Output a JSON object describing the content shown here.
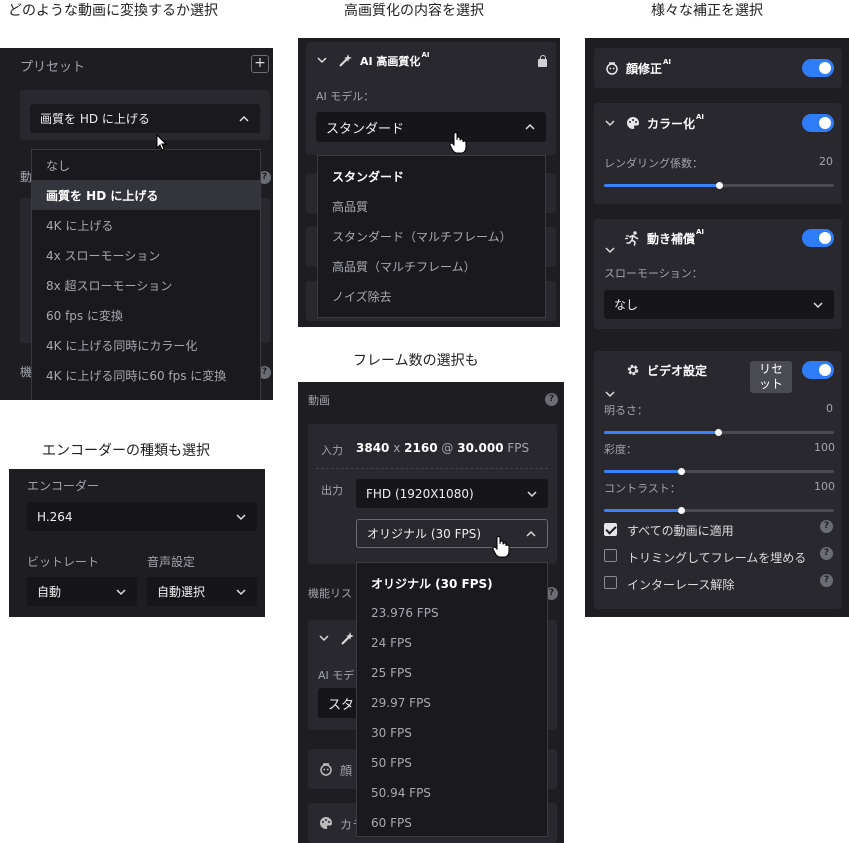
{
  "captions": {
    "c1": "どのような動画に変換するか選択",
    "c2": "高画質化の内容を選択",
    "c3": "様々な補正を選択",
    "c4": "エンコーダーの種類も選択",
    "c5": "フレーム数の選択も"
  },
  "preset_panel": {
    "title": "プリセット",
    "add": "+",
    "selected": "画質を HD に上げる",
    "options": [
      "なし",
      "画質を HD に上げる",
      "4K に上げる",
      "4x スローモーション",
      "8x 超スローモーション",
      "60 fps に変換",
      "4K に上げる同時にカラー化",
      "4K に上げる同時に60 fps に変換"
    ],
    "behind_label_1": "動",
    "behind_label_2": "機"
  },
  "enhance_panel": {
    "title": "AI 高画質化",
    "sup": "AI",
    "model_label": "AI モデル：",
    "selected": "スタンダード",
    "options": [
      "スタンダード",
      "高品質",
      "スタンダード（マルチフレーム）",
      "高品質（マルチフレーム）",
      "ノイズ除去"
    ]
  },
  "encoder_panel": {
    "encoder_label": "エンコーダー",
    "encoder_value": "H.264",
    "bitrate_label": "ビットレート",
    "bitrate_value": "自動",
    "audio_label": "音声設定",
    "audio_value": "自動選択"
  },
  "frame_panel": {
    "video_label": "動画",
    "input_label": "入力",
    "input_w": "3840",
    "input_x": "x",
    "input_h": "2160",
    "input_at": "@",
    "input_fps": "30.000",
    "input_fps_unit": "FPS",
    "output_label": "出力",
    "output_res": "FHD (1920X1080)",
    "output_fps": "オリジナル (30 FPS)",
    "fps_options": [
      "オリジナル (30 FPS)",
      "23.976 FPS",
      "24 FPS",
      "25 FPS",
      "29.97 FPS",
      "30 FPS",
      "50 FPS",
      "50.94 FPS",
      "60 FPS"
    ],
    "feature_list_label": "機能リス",
    "ai_model_partial": "AI モデ",
    "standard_partial": "スタン",
    "face_partial": "顔",
    "color_partial": "カラ"
  },
  "correction_panel": {
    "face": "顔修正",
    "face_sup": "AI",
    "colorize": "カラー化",
    "colorize_sup": "AI",
    "render_label": "レンダリング係数：",
    "render_value": "20",
    "render_level": 0.2,
    "motion": "動き補償",
    "motion_sup": "AI",
    "slowmo_label": "スローモーション：",
    "slowmo_value": "なし",
    "video_settings": "ビデオ設定",
    "reset": "リセット",
    "brightness_label": "明るさ：",
    "brightness_value": "0",
    "saturation_label": "彩度：",
    "saturation_value": "100",
    "contrast_label": "コントラスト：",
    "contrast_value": "100",
    "apply_all": "すべての動画に適用",
    "trim_fill": "トリミングしてフレームを埋める",
    "deinterlace": "インターレース解除",
    "help": "?"
  }
}
